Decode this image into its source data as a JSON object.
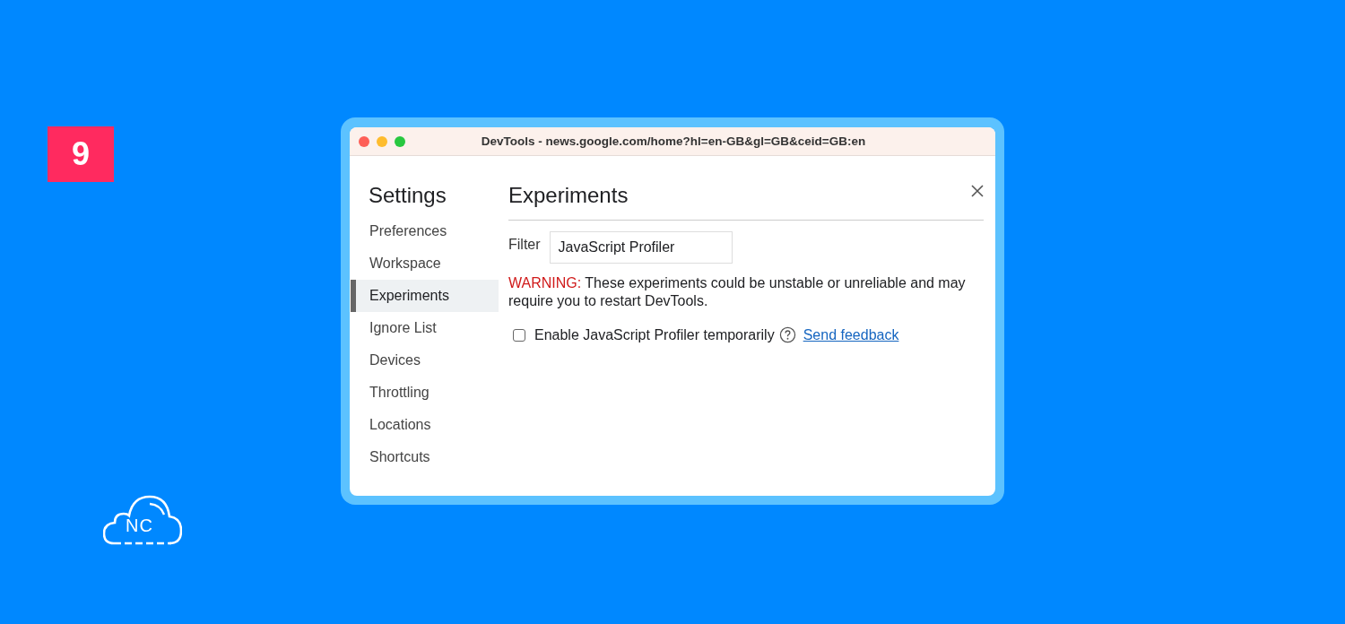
{
  "badge": "9",
  "logo": {
    "text": "NC"
  },
  "window": {
    "title": "DevTools - news.google.com/home?hl=en-GB&gl=GB&ceid=GB:en"
  },
  "sidebar": {
    "title": "Settings",
    "items": [
      {
        "label": "Preferences",
        "selected": false
      },
      {
        "label": "Workspace",
        "selected": false
      },
      {
        "label": "Experiments",
        "selected": true
      },
      {
        "label": "Ignore List",
        "selected": false
      },
      {
        "label": "Devices",
        "selected": false
      },
      {
        "label": "Throttling",
        "selected": false
      },
      {
        "label": "Locations",
        "selected": false
      },
      {
        "label": "Shortcuts",
        "selected": false
      }
    ]
  },
  "panel": {
    "title": "Experiments",
    "filter": {
      "label": "Filter",
      "value": "JavaScript Profiler"
    },
    "warning": {
      "label": "WARNING:",
      "text": "These experiments could be unstable or unreliable and may require you to restart DevTools."
    },
    "experiments": [
      {
        "label": "Enable JavaScript Profiler temporarily",
        "checked": false,
        "link": "Send feedback"
      }
    ]
  }
}
